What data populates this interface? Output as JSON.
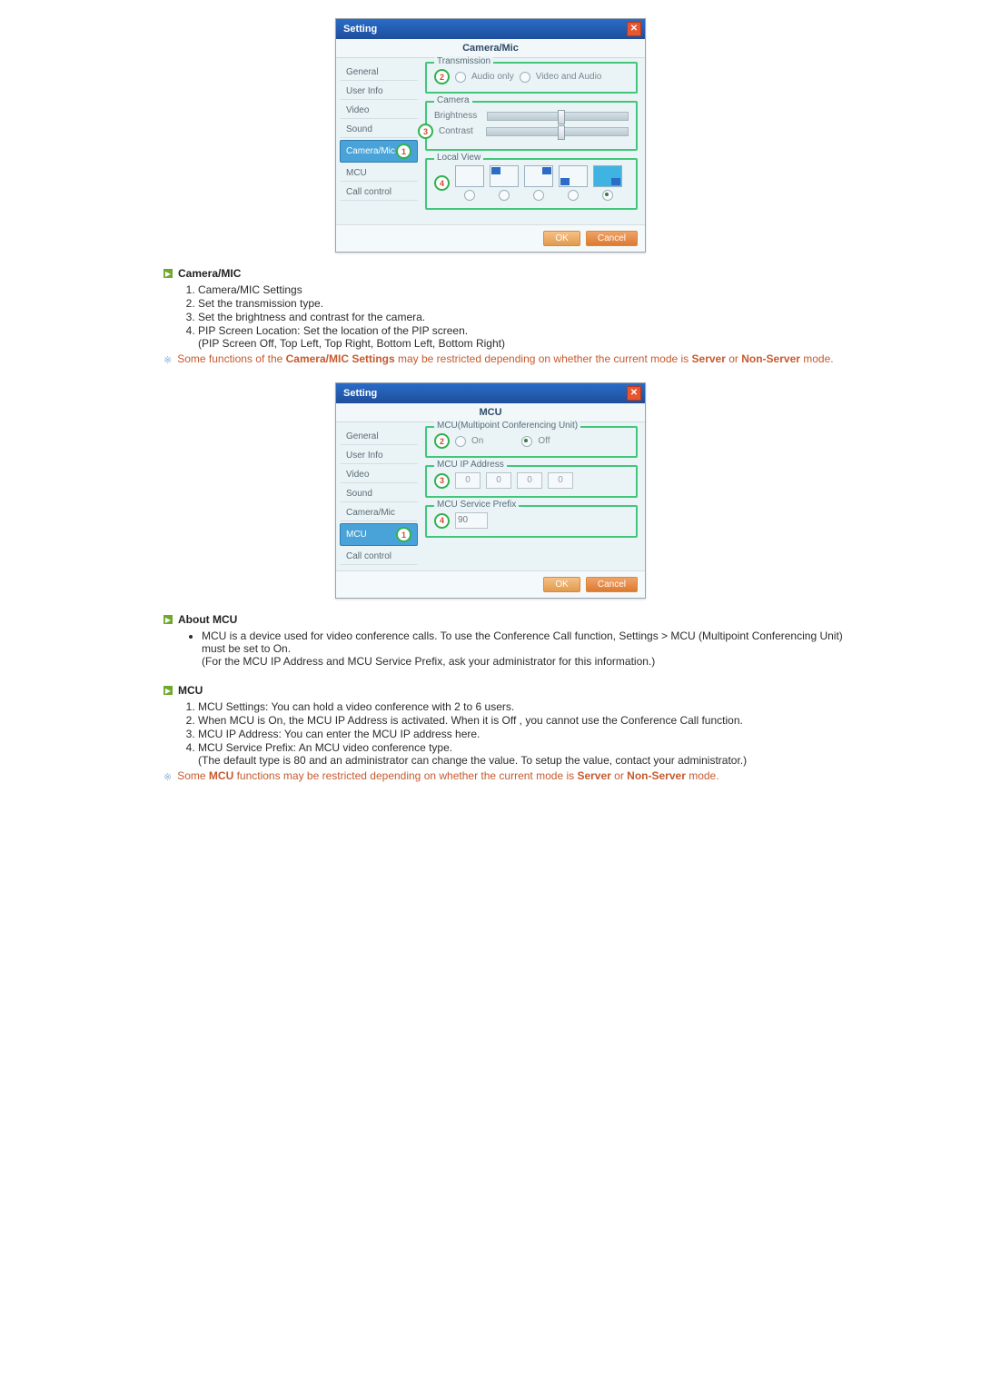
{
  "dialog1": {
    "title": "Setting",
    "section": "Camera/Mic",
    "sidebar": [
      "General",
      "User Info",
      "Video",
      "Sound",
      "Camera/Mic",
      "MCU",
      "Call control"
    ],
    "selected_index": 4,
    "transmission": {
      "label": "Transmission",
      "opt1": "Audio only",
      "opt2": "Video and Audio"
    },
    "camera_group": {
      "label": "Camera",
      "brightness": "Brightness",
      "contrast": "Contrast"
    },
    "localview_label": "Local View",
    "ok": "OK",
    "cancel": "Cancel"
  },
  "cammic_section": {
    "heading": "Camera/MIC",
    "items": [
      "Camera/MIC Settings",
      "Set the transmission type.",
      "Set the brightness and contrast for the camera.",
      "PIP Screen Location: Set the location of the PIP screen."
    ],
    "subline": "(PIP Screen Off, Top Left, Top Right, Bottom Left, Bottom Right)",
    "note_prefix": "Some functions of the ",
    "note_bold1": "Camera/MIC Settings",
    "note_mid": " may be restricted depending on whether the current mode is ",
    "note_bold2": "Server",
    "note_or": " or ",
    "note_bold3": "Non-Server",
    "note_suffix": " mode."
  },
  "dialog2": {
    "title": "Setting",
    "section": "MCU",
    "sidebar": [
      "General",
      "User Info",
      "Video",
      "Sound",
      "Camera/Mic",
      "MCU",
      "Call control"
    ],
    "selected_index": 5,
    "group1": {
      "label": "MCU(Multipoint Conferencing Unit)",
      "on": "On",
      "off": "Off"
    },
    "group2_label": "MCU IP Address",
    "ip": [
      "0",
      "0",
      "0",
      "0"
    ],
    "group3_label": "MCU Service Prefix",
    "prefix_value": "90",
    "ok": "OK",
    "cancel": "Cancel"
  },
  "about_mcu": {
    "heading": "About MCU",
    "bullets": [
      "MCU is a device used for video conference calls. To use the Conference Call function, Settings > MCU (Multipoint Conferencing Unit) must be set to On.",
      "(For the MCU IP Address and MCU Service Prefix, ask your administrator for this information.)"
    ]
  },
  "mcu_section": {
    "heading": "MCU",
    "items": [
      "MCU Settings: You can hold a video conference with 2 to 6 users.",
      "When MCU is On, the MCU IP Address is activated. When it is Off , you cannot use the Conference Call function.",
      "MCU IP Address: You can enter the MCU IP address here.",
      "MCU Service Prefix: An MCU video conference type."
    ],
    "subline": "(The default type is 80 and an administrator can change the value. To setup the value, contact your administrator.)",
    "note_prefix": "Some ",
    "note_bold1": "MCU",
    "note_mid": " functions may be restricted depending on whether the current mode is ",
    "note_bold2": "Server",
    "note_or": " or ",
    "note_bold3": "Non-Server",
    "note_suffix": " mode."
  }
}
